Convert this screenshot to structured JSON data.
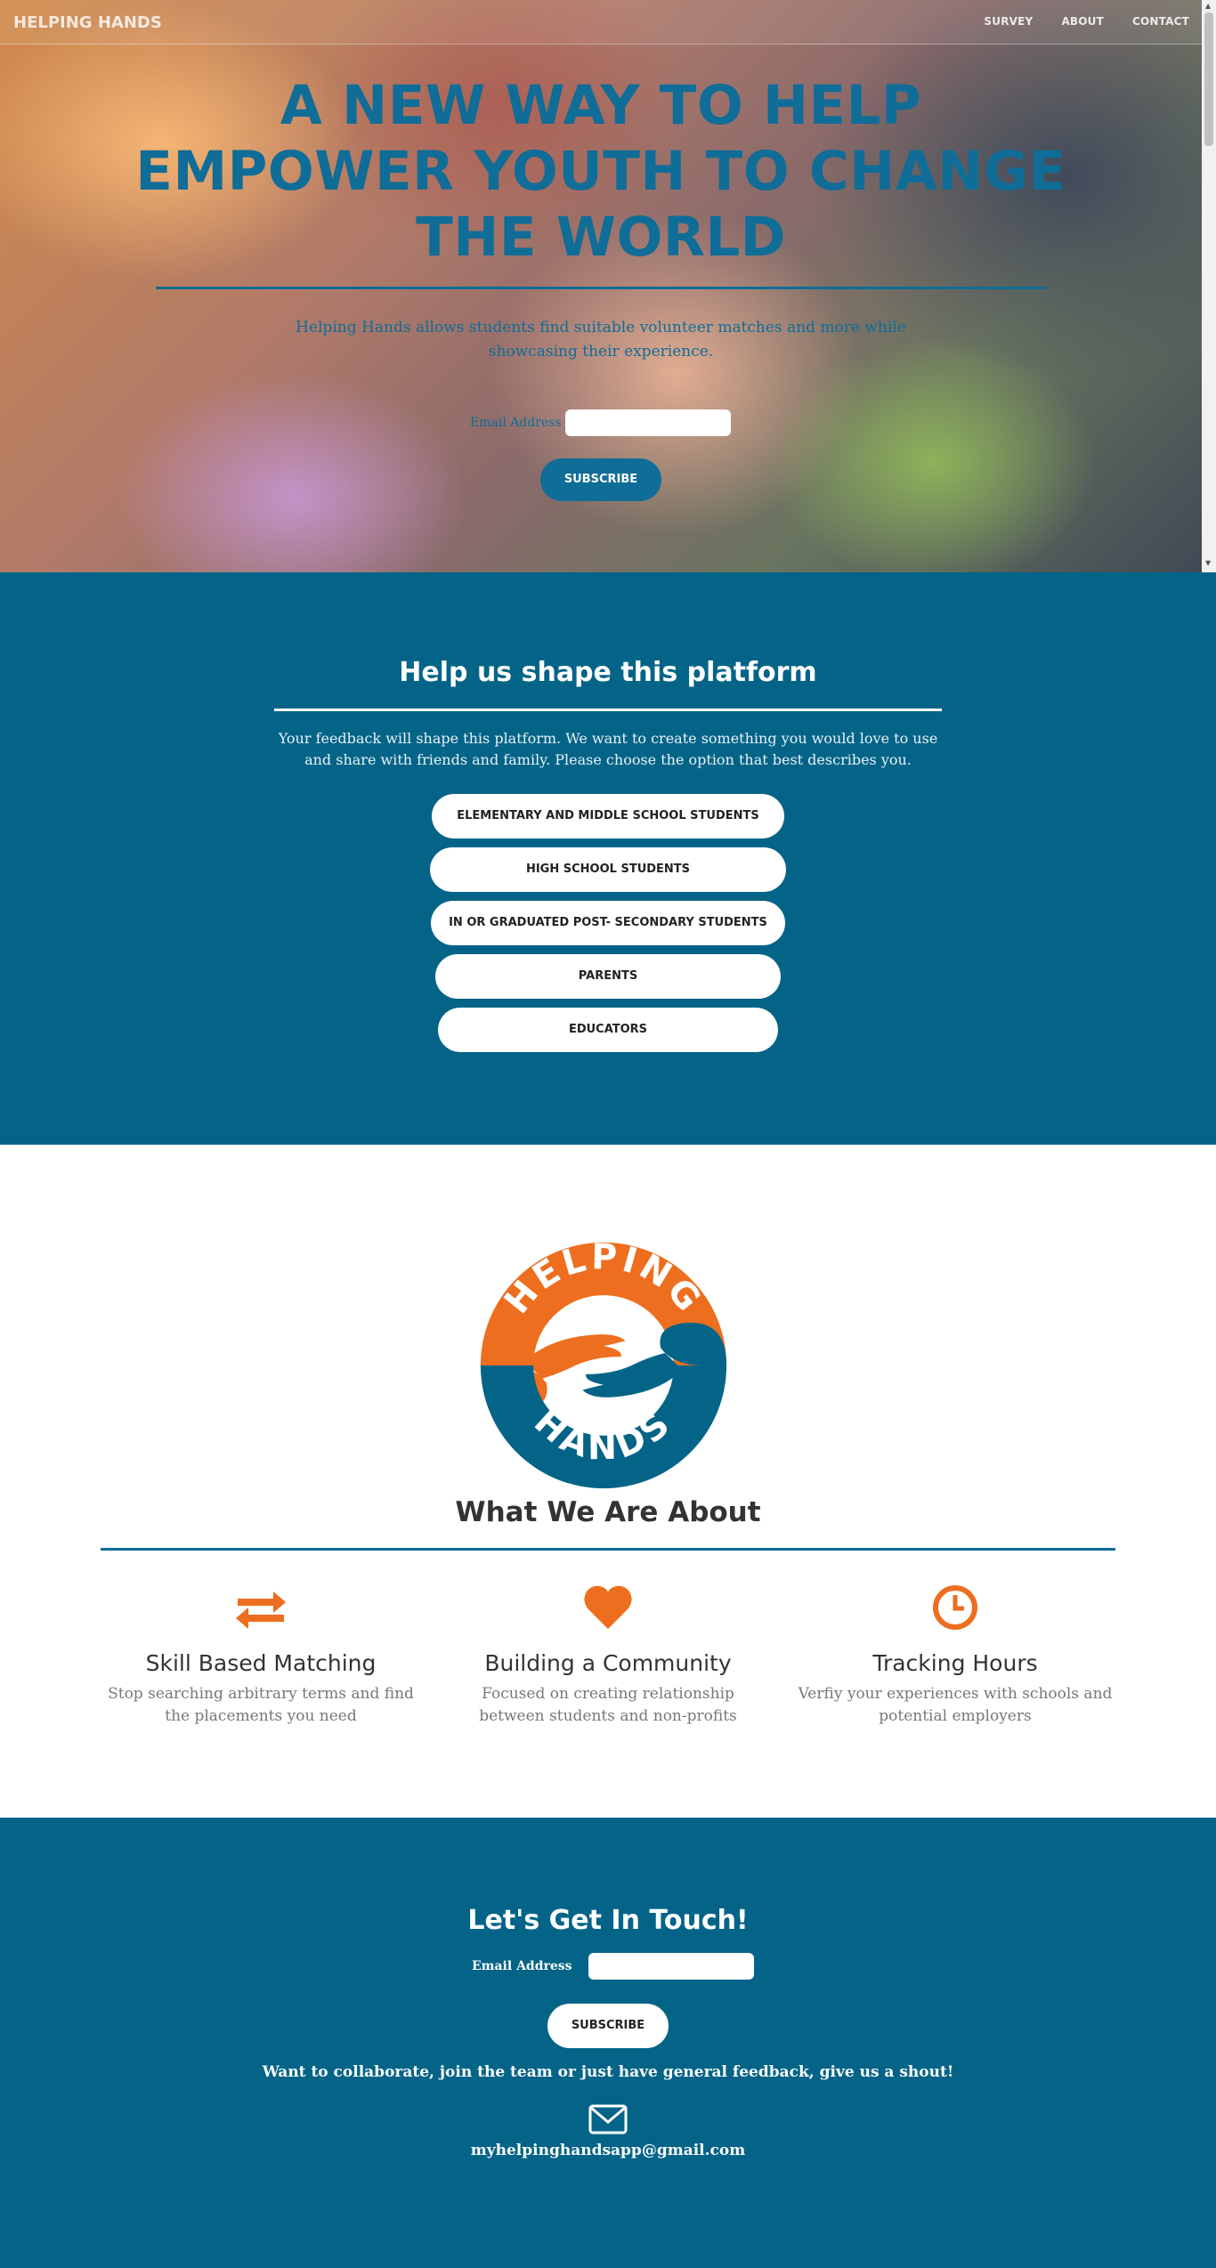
{
  "nav": {
    "brand": "HELPING HANDS",
    "links": [
      "SURVEY",
      "ABOUT",
      "CONTACT"
    ]
  },
  "hero": {
    "title": "A NEW WAY TO HELP EMPOWER YOUTH TO CHANGE THE WORLD",
    "subtitle": "Helping Hands allows students find suitable volunteer matches and more while showcasing their experience.",
    "email_label": "Email Address",
    "subscribe_label": "SUBSCRIBE"
  },
  "survey": {
    "title": "Help us shape this platform",
    "description": "Your feedback will shape this platform. We want to create something you would love to use and share with friends and family. Please choose the option that best describes you.",
    "options": [
      "ELEMENTARY AND MIDDLE SCHOOL STUDENTS",
      "HIGH SCHOOL STUDENTS",
      "IN OR GRADUATED POST- SECONDARY STUDENTS",
      "PARENTS",
      "EDUCATORS"
    ]
  },
  "about": {
    "logo_top_text": "HELPING",
    "logo_bottom_text": "HANDS",
    "title": "What We Are About",
    "features": [
      {
        "icon": "exchange-arrows-icon",
        "title": "Skill Based Matching",
        "text": "Stop searching arbitrary terms and find the placements you need"
      },
      {
        "icon": "heart-icon",
        "title": "Building a Community",
        "text": "Focused on creating relationship between students and non-profits"
      },
      {
        "icon": "clock-icon",
        "title": "Tracking Hours",
        "text": "Verfiy your experiences with schools and potential employers"
      }
    ]
  },
  "contact": {
    "title": "Let's Get In Touch!",
    "email_label": "Email Address",
    "subscribe_label": "SUBSCRIBE",
    "note": "Want to collaborate, join the team or just have general feedback, give us a shout!",
    "email": "myhelpinghandsapp@gmail.com"
  },
  "colors": {
    "primary_blue": "#046488",
    "accent_orange": "#ee6e1f",
    "white": "#ffffff"
  }
}
